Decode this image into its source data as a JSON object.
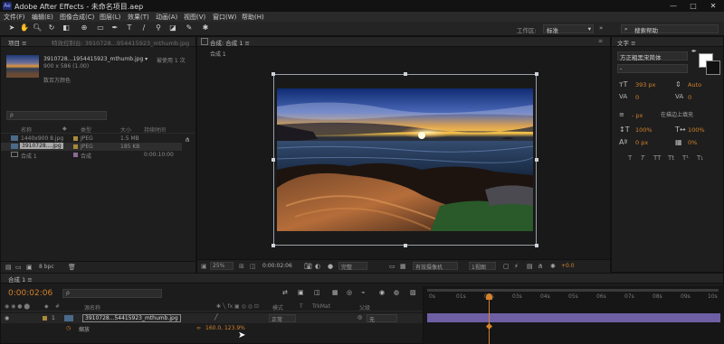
{
  "window": {
    "title": "Adobe After Effects - 未命名项目.aep",
    "logo": "Ae",
    "controls": [
      "—",
      "□",
      "✕"
    ]
  },
  "menu": [
    "文件(F)",
    "编辑(E)",
    "图像合成(C)",
    "图层(L)",
    "效果(T)",
    "动画(A)",
    "视图(V)",
    "窗口(W)",
    "帮助(H)"
  ],
  "toolbar": {
    "workspace_label": "工作区:",
    "workspace_value": "标准",
    "search_placeholder": "搜索帮助"
  },
  "project": {
    "tabs": [
      "项目 ≡",
      "特效控制台: 3910728...954415923_mthumb.jpg"
    ],
    "thumb_name": "3910728...1954415923_mthumb.jpg ▾",
    "thumb_usage": "被使用 1 次",
    "thumb_info": "900 x 586 (1.00)",
    "thumb_color": "数百万颜色",
    "search_placeholder": "ρ",
    "columns": [
      "名称",
      "",
      "类型",
      "大小",
      "持续时间"
    ],
    "items": [
      {
        "name": "1440x900 8.jpg",
        "type": "JPEG",
        "size": "1.5 MB",
        "duration": ""
      },
      {
        "name": "3910728....jpg",
        "type": "JPEG",
        "size": "185 KB",
        "duration": ""
      },
      {
        "name": "合成 1",
        "type": "合成",
        "size": "",
        "duration": "0:00:10:00"
      }
    ],
    "bottom_label": "8 bpc"
  },
  "composition": {
    "tab": "合成: 合成 1 ≡",
    "breadcrumb": "合成 1",
    "zoom": "25%",
    "timecode": "0:00:02:06",
    "resolution": "完整",
    "camera": "有效摄像机",
    "views": "1视图",
    "exposure": "+0.0"
  },
  "character": {
    "tab": "文字 ≡",
    "font": "方正粗黑宋简体",
    "style": "-",
    "size": "393 px",
    "leading": "Auto",
    "kerning": "0",
    "tracking": "0",
    "stroke_width": "- px",
    "stroke_mode": "在描边上填充",
    "vscale": "100%",
    "hscale": "100%",
    "baseline": "0 px",
    "tsume": "0%",
    "styles": [
      "T",
      "T",
      "TT",
      "Tt",
      "T¹",
      "T₁"
    ]
  },
  "timeline": {
    "tab": "合成 1 ≡",
    "timecode": "0:00:02:06",
    "search_placeholder": "ρ",
    "columns": [
      "源名称",
      "模式",
      "T",
      "TrkMat",
      "父级"
    ],
    "layer": {
      "index": "1",
      "name": "3910728...54415923_mthumb.jpg",
      "mode": "正常",
      "parent": "无"
    },
    "prop": {
      "name": "缩放",
      "value": "160.0, 123.9%"
    },
    "ruler": [
      "0s",
      "01s",
      "02s",
      "03s",
      "04s",
      "05s",
      "06s",
      "07s",
      "08s",
      "09s",
      "10s"
    ]
  }
}
